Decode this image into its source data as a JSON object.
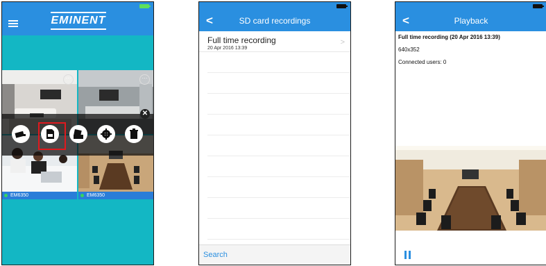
{
  "screen1": {
    "brand": "EMINENT",
    "cameras": [
      {
        "label": ""
      },
      {
        "label": ""
      },
      {
        "label": "EM6350"
      },
      {
        "label": "EM6350"
      }
    ],
    "partial_labels": [
      "EM",
      "EM"
    ],
    "actions": [
      "camera-icon",
      "sd-card-icon",
      "snapshot-icon",
      "gear-icon",
      "trash-icon"
    ],
    "highlight_color": "#e0191e",
    "accent": "#2a8fe0",
    "background": "#13b7c4"
  },
  "screen2": {
    "back": "<",
    "title": "SD card recordings",
    "recordings": [
      {
        "title": "Full time recording",
        "date": "20 Apr 2016 13:39"
      }
    ],
    "search_label": "Search"
  },
  "screen3": {
    "back": "<",
    "title": "Playback",
    "recording_title": "Full time recording (20 Apr 2016 13:39)",
    "resolution": "640x352",
    "connected_users": "Connected users: 0"
  }
}
